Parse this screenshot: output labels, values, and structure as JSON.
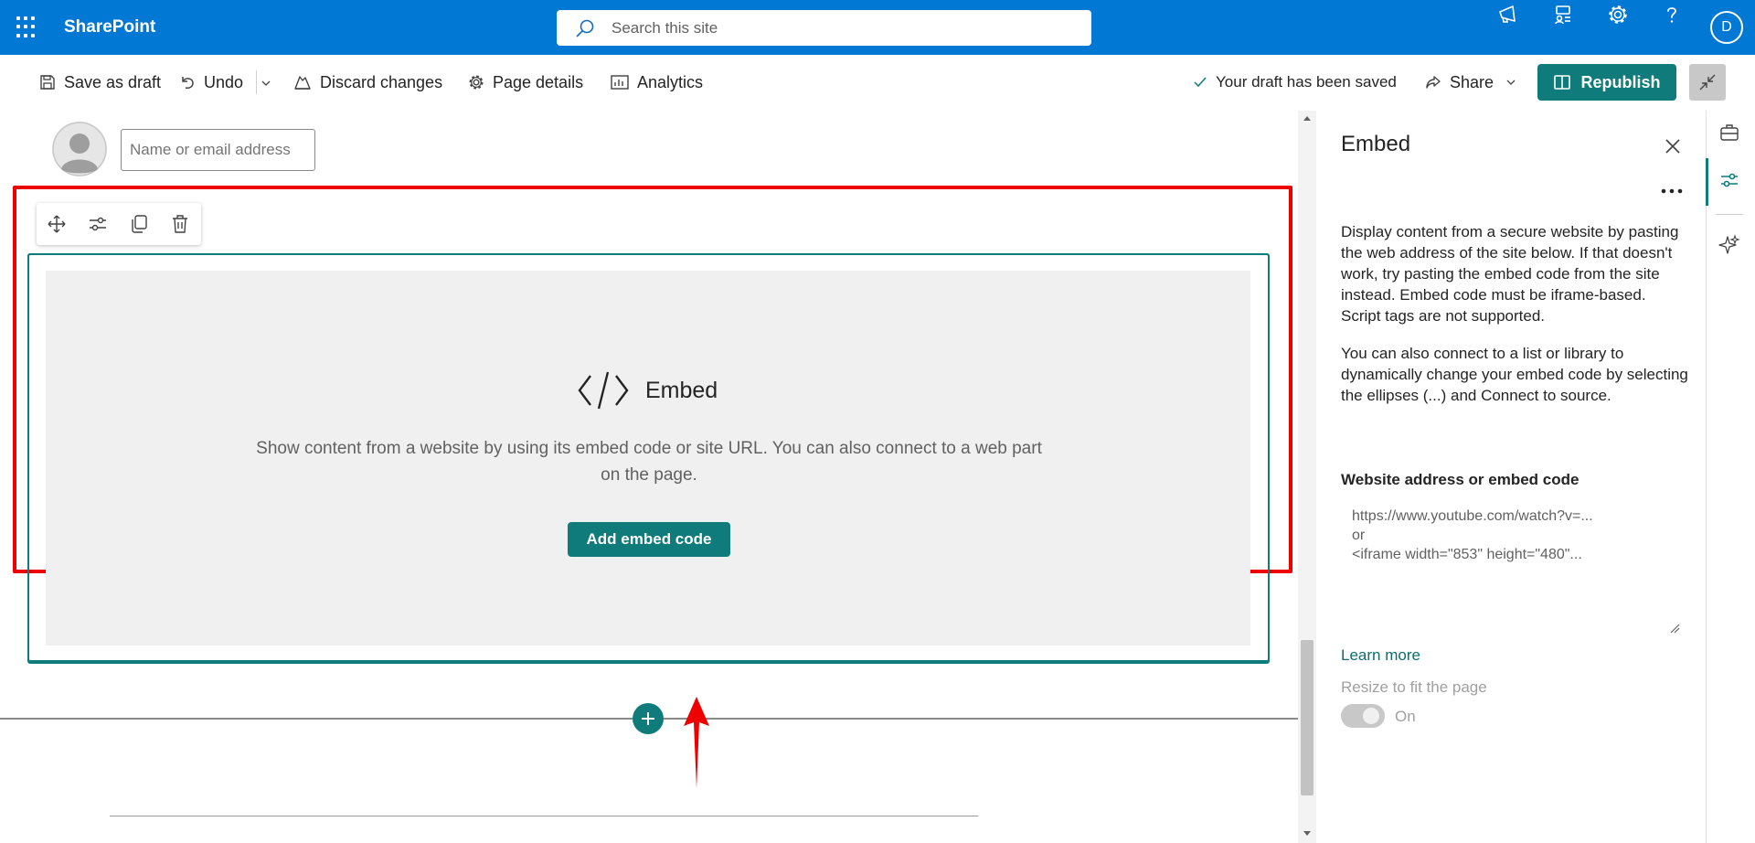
{
  "app": {
    "name": "SharePoint",
    "user_initial": "D"
  },
  "search": {
    "placeholder": "Search this site"
  },
  "toolbar": {
    "save_draft": "Save as draft",
    "undo": "Undo",
    "discard": "Discard changes",
    "page_details": "Page details",
    "analytics": "Analytics",
    "status": "Your draft has been saved",
    "share": "Share",
    "republish": "Republish"
  },
  "canvas": {
    "name_placeholder": "Name or email address",
    "webpart": {
      "title": "Embed",
      "description": "Show content from a website by using its embed code or site URL. You can also connect to a web part on the page.",
      "button": "Add embed code"
    }
  },
  "pane": {
    "title": "Embed",
    "paragraph1": "Display content from a secure website by pasting the web address of the site below. If that doesn't work, try pasting the embed code from the site instead. Embed code must be iframe-based. Script tags are not supported.",
    "paragraph2": "You can also connect to a list or library to dynamically change your embed code by selecting the ellipses (...) and Connect to source.",
    "field_label": "Website address or embed code",
    "field_placeholder": "https://www.youtube.com/watch?v=...\nor\n<iframe width=\"853\" height=\"480\"...",
    "learn_more": "Learn more",
    "resize_label": "Resize to fit the page",
    "resize_state": "On"
  },
  "colors": {
    "brand": "#0078d4",
    "accent": "#0f7b7b",
    "highlight": "#ee0000"
  }
}
